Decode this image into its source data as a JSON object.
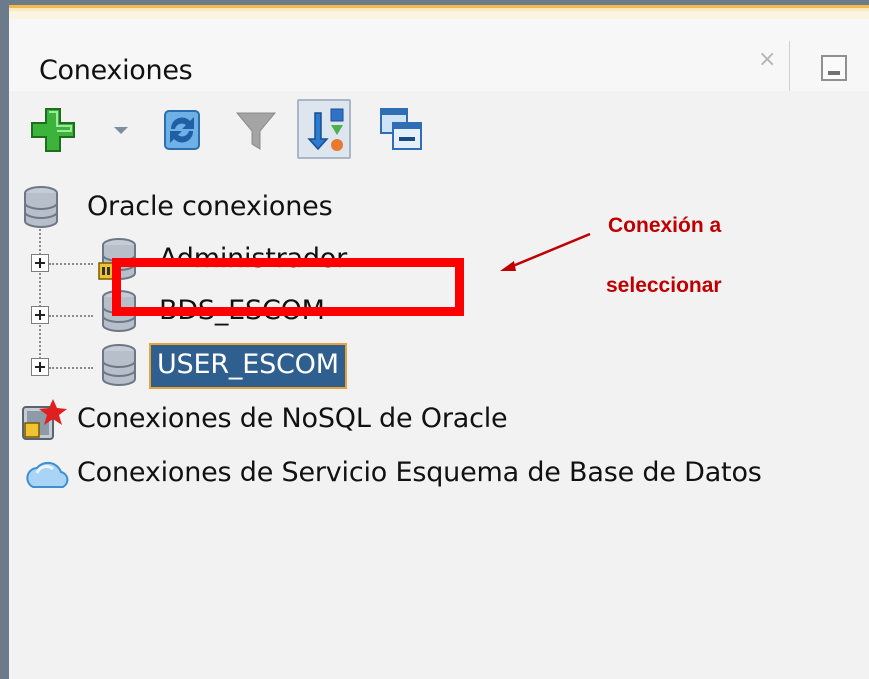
{
  "panel": {
    "title": "Conexiones",
    "close_glyph": "×"
  },
  "toolbar": {
    "buttons": [
      {
        "name": "add-connection-button",
        "icon": "green-plus-icon"
      },
      {
        "name": "add-dropdown-button",
        "icon": "dropdown-arrow-icon"
      },
      {
        "name": "refresh-button",
        "icon": "refresh-icon"
      },
      {
        "name": "filter-button",
        "icon": "filter-icon"
      },
      {
        "name": "sort-button",
        "icon": "sort-icon",
        "pressed": true
      },
      {
        "name": "collapse-all-button",
        "icon": "collapse-icon"
      }
    ]
  },
  "tree": {
    "root": "Oracle conexiones",
    "connections": [
      "Administrador",
      "BDS_ESCOM",
      "USER_ESCOM"
    ],
    "selected": "USER_ESCOM",
    "nosql": "Conexiones de NoSQL de Oracle",
    "schema_service": "Conexiones de Servicio Esquema de Base de Datos"
  },
  "annotation": {
    "line1": "Conexión a",
    "line2": "seleccionar",
    "color": "#c00000",
    "box_color": "#ff0000"
  },
  "colors": {
    "selection_bg": "#2f5f8f",
    "selection_border": "#e8a23a"
  }
}
